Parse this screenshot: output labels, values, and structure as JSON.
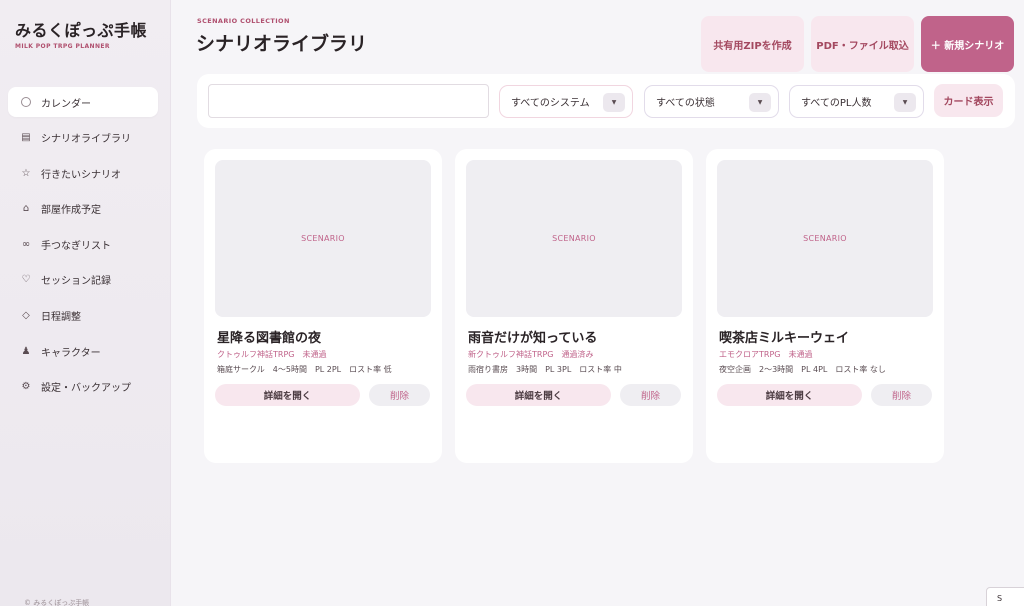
{
  "app": {
    "title": "みるくぽっぷ手帳",
    "subtitle": "MILK POP TRPG PLANNER",
    "footer": "© みるくぽっぷ手帳"
  },
  "sidebar": {
    "items": [
      {
        "label": "カレンダー",
        "icon": "calendar-circle-icon",
        "glyph": "",
        "active": true
      },
      {
        "label": "シナリオライブラリ",
        "icon": "library-icon",
        "glyph": "▤",
        "active": false
      },
      {
        "label": "行きたいシナリオ",
        "icon": "star-icon",
        "glyph": "☆",
        "active": false
      },
      {
        "label": "部屋作成予定",
        "icon": "house-icon",
        "glyph": "⌂",
        "active": false
      },
      {
        "label": "手つなぎリスト",
        "icon": "infinity-icon",
        "glyph": "∞",
        "active": false
      },
      {
        "label": "セッション記録",
        "icon": "heart-icon",
        "glyph": "♡",
        "active": false
      },
      {
        "label": "日程調整",
        "icon": "diamond-icon",
        "glyph": "◇",
        "active": false
      },
      {
        "label": "キャラクター",
        "icon": "person-icon",
        "glyph": "♟",
        "active": false
      },
      {
        "label": "設定・バックアップ",
        "icon": "gear-icon",
        "glyph": "⚙",
        "active": false
      }
    ]
  },
  "header": {
    "eyebrow": "SCENARIO COLLECTION",
    "title": "シナリオライブラリ",
    "zip_button": "共有用ZIPを作成",
    "pdf_button": "PDF・ファイル取込",
    "new_button": "＋ 新規シナリオ"
  },
  "filters": {
    "search_value": "",
    "system_select": "すべてのシステム",
    "status_select": "すべての状態",
    "players_select": "すべてのPL人数",
    "view_button": "カード表示"
  },
  "cards": [
    {
      "thumb_label": "SCENARIO",
      "title": "星降る図書館の夜",
      "system_status": "クトゥルフ神話TRPG　未通過",
      "meta": "箱庭サークル　4〜5時間　PL 2PL　ロスト率 低",
      "detail": "詳細を開く",
      "delete": "削除"
    },
    {
      "thumb_label": "SCENARIO",
      "title": "雨音だけが知っている",
      "system_status": "新クトゥルフ神話TRPG　通過済み",
      "meta": "雨宿り書房　3時間　PL 3PL　ロスト率 中",
      "detail": "詳細を開く",
      "delete": "削除"
    },
    {
      "thumb_label": "SCENARIO",
      "title": "喫茶店ミルキーウェイ",
      "system_status": "エモクロアTRPG　未通過",
      "meta": "夜空企画　2〜3時間　PL 4PL　ロスト率 なし",
      "detail": "詳細を開く",
      "delete": "削除"
    }
  ],
  "corner": {
    "label": "S"
  },
  "colors": {
    "accent": "#c0638a",
    "accent_light": "#f8e7ee",
    "background": "#f6f5f8"
  }
}
